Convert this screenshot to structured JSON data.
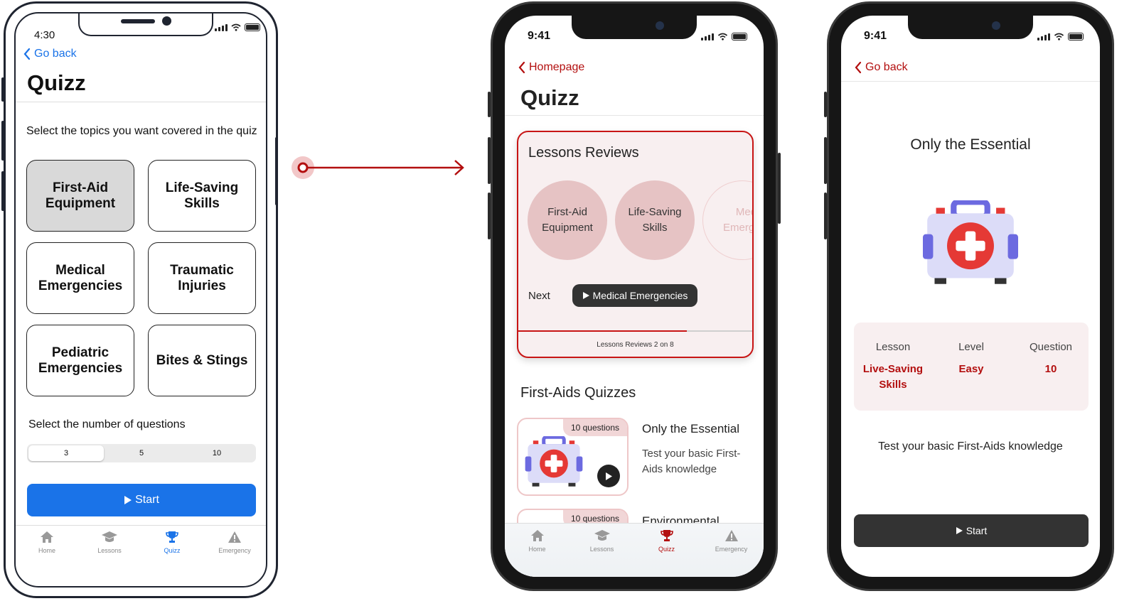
{
  "wireframe": {
    "status_time": "4:30",
    "back_label": "Go back",
    "title": "Quizz",
    "prompt": "Select the topics you want covered in the quiz",
    "topics": [
      {
        "label": "First-Aid Equipment",
        "selected": true
      },
      {
        "label": "Life-Saving Skills",
        "selected": false
      },
      {
        "label": "Medical Emergencies",
        "selected": false
      },
      {
        "label": "Traumatic Injuries",
        "selected": false
      },
      {
        "label": "Pediatric Emergencies",
        "selected": false
      },
      {
        "label": "Bites & Stings",
        "selected": false
      }
    ],
    "questions_label": "Select the number of questions",
    "question_options": [
      "3",
      "5",
      "10"
    ],
    "selected_option": "3",
    "start_label": "Start",
    "tabs": [
      {
        "label": "Home",
        "icon": "home-icon"
      },
      {
        "label": "Lessons",
        "icon": "graduation-cap-icon"
      },
      {
        "label": "Quizz",
        "icon": "trophy-icon",
        "active": true
      },
      {
        "label": "Emergency",
        "icon": "warning-icon"
      }
    ],
    "accent": "#1a73e8"
  },
  "quiz_screen": {
    "status_time": "9:41",
    "back_label": "Homepage",
    "title": "Quizz",
    "review_card": {
      "heading": "Lessons Reviews",
      "lessons": [
        "First-Aid Equipment",
        "Life-Saving Skills",
        "Medical Emergencies"
      ],
      "next_label": "Next",
      "next_button": "Medical Emergencies",
      "progress_fraction": 0.72,
      "progress_label": "Lessons Reviews 2 on 8"
    },
    "section_title": "First-Aids Quizzes",
    "quizzes": [
      {
        "badge": "10 questions",
        "title": "Only the Essential",
        "description": "Test your basic First-Aids knowledge"
      },
      {
        "badge": "10 questions",
        "title": "Environmental"
      }
    ],
    "tabs": [
      {
        "label": "Home",
        "icon": "home-icon"
      },
      {
        "label": "Lessons",
        "icon": "graduation-cap-icon"
      },
      {
        "label": "Quizz",
        "icon": "trophy-icon",
        "active": true
      },
      {
        "label": "Emergency",
        "icon": "warning-icon"
      }
    ],
    "accent": "#b30f0f"
  },
  "detail_screen": {
    "status_time": "9:41",
    "back_label": "Go back",
    "title": "Only the Essential",
    "info": [
      {
        "key": "Lesson",
        "value": "Live-Saving Skills"
      },
      {
        "key": "Level",
        "value": "Easy"
      },
      {
        "key": "Question",
        "value": "10"
      }
    ],
    "description": "Test your basic First-Aids knowledge",
    "start_label": "Start"
  }
}
